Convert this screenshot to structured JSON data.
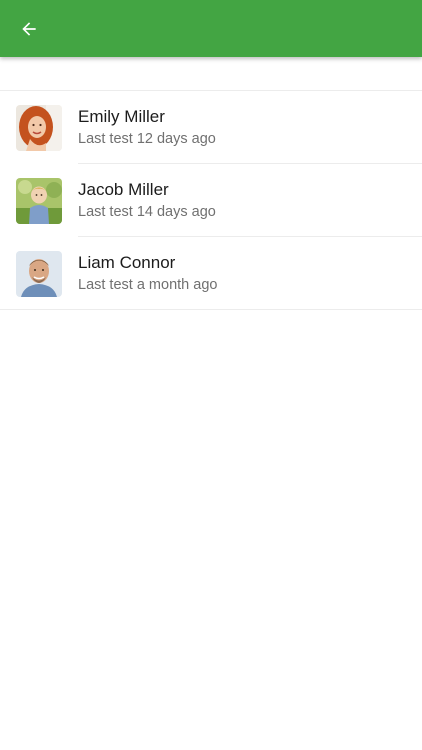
{
  "appbar": {
    "color": "#43a543",
    "back_icon": "arrow-left-icon"
  },
  "people": [
    {
      "name": "Emily Miller",
      "last_test": "Last test 12 days ago",
      "avatar": "photo-red-haired-woman"
    },
    {
      "name": "Jacob Miller",
      "last_test": "Last test 14 days ago",
      "avatar": "photo-boy-outdoors"
    },
    {
      "name": "Liam Connor",
      "last_test": "Last test a month ago",
      "avatar": "photo-smiling-man"
    }
  ]
}
